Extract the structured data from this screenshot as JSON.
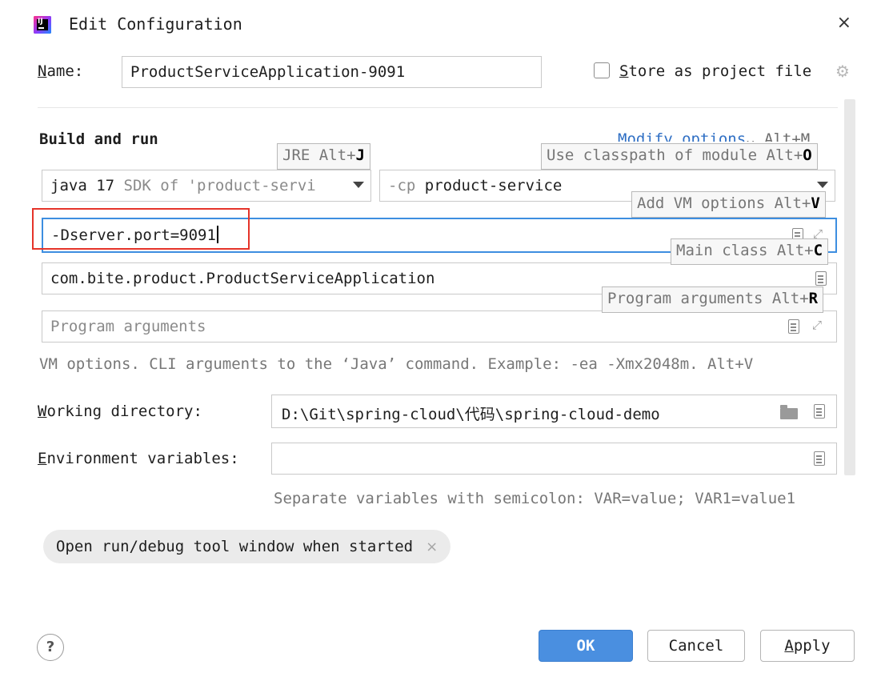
{
  "window": {
    "title": "Edit Configuration",
    "close_glyph": "×"
  },
  "name": {
    "label_first": "N",
    "label_rest": "ame:",
    "value": "ProductServiceApplication-9091"
  },
  "store": {
    "label_first": "S",
    "label_rest": "tore as project file",
    "checked": false
  },
  "build": {
    "title": "Build and run",
    "modify_options": "Modify options",
    "modify_shortcut": "⌄ Alt+M"
  },
  "jre": {
    "java": "java 17",
    "sdk_text": "SDK of 'product-servi"
  },
  "classpath": {
    "prefix": "-cp",
    "module": "product-service"
  },
  "vm_options": {
    "value": "-Dserver.port=9091"
  },
  "main_class": {
    "value": "com.bite.product.ProductServiceApplication"
  },
  "program_args": {
    "placeholder": "Program arguments"
  },
  "tooltips": {
    "jre": {
      "text": "JRE Alt+",
      "key": "J"
    },
    "classpath": {
      "text": "Use classpath of module Alt+",
      "key": "O"
    },
    "vm": {
      "text": "Add VM options Alt+",
      "key": "V"
    },
    "main": {
      "text": "Main class Alt+",
      "key": "C"
    },
    "args": {
      "text": "Program arguments Alt+",
      "key": "R"
    }
  },
  "vm_hint": "VM options. CLI arguments to the ‘Java’ command. Example: -ea -Xmx2048m. Alt+V",
  "working_dir": {
    "label_first": "W",
    "label_rest": "orking directory:",
    "value": "D:\\Git\\spring-cloud\\代码\\spring-cloud-demo"
  },
  "env": {
    "label_first": "E",
    "label_rest": "nvironment variables:",
    "value": "",
    "hint": "Separate variables with semicolon: VAR=value; VAR1=value1"
  },
  "chip": {
    "label": "Open run/debug tool window when started",
    "close_glyph": "×"
  },
  "buttons": {
    "help": "?",
    "ok": "OK",
    "cancel": "Cancel",
    "apply_first": "A",
    "apply_rest": "pply"
  },
  "colors": {
    "accent": "#4a8fe0",
    "highlight_box": "#e5342a",
    "focus_border": "#3d8ee0",
    "link": "#2f6fc4"
  }
}
